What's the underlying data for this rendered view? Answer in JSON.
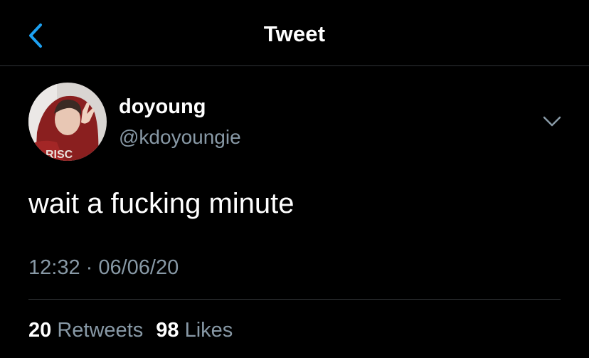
{
  "header": {
    "title": "Tweet",
    "back_icon": "chevron-left-icon",
    "accent": "#1da1f2"
  },
  "tweet": {
    "author_name": "doyoung",
    "author_handle": "@kdoyoungie",
    "text": "wait a fucking minute",
    "timestamp": "12:32 · 06/06/20",
    "menu_icon": "chevron-down-icon"
  },
  "stats": {
    "retweets_count": "20",
    "retweets_label": "Retweets",
    "likes_count": "98",
    "likes_label": "Likes"
  },
  "colors": {
    "background": "#000000",
    "secondary_text": "#8899a6",
    "divider": "#2f3336"
  }
}
